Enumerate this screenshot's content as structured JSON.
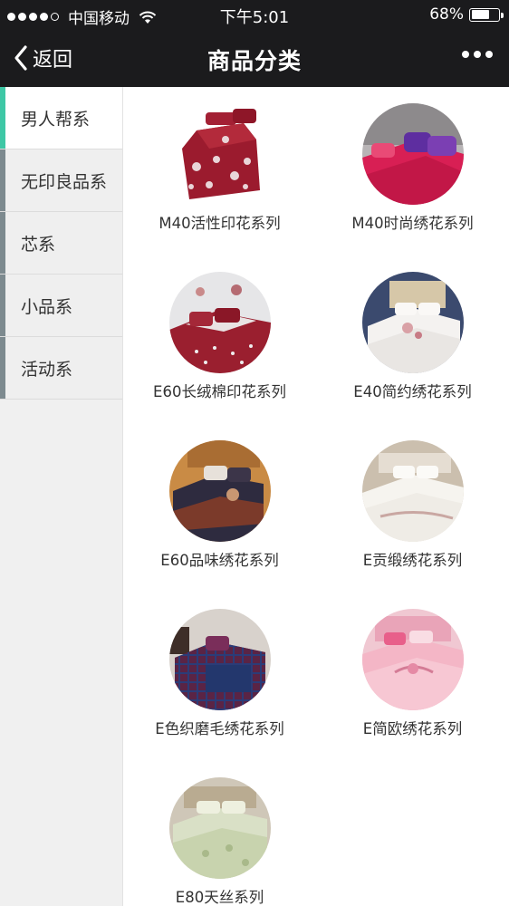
{
  "status_bar": {
    "carrier": "中国移动",
    "time": "下午5:01",
    "battery": "68%",
    "battery_level": 0.68
  },
  "nav": {
    "back_label": "返回",
    "title": "商品分类",
    "more_icon": "ellipsis-icon"
  },
  "sidebar": {
    "items": [
      {
        "label": "男人帮系",
        "active": true
      },
      {
        "label": "无印良品系",
        "active": false
      },
      {
        "label": "芯系",
        "active": false
      },
      {
        "label": "小品系",
        "active": false
      },
      {
        "label": "活动系",
        "active": false
      }
    ]
  },
  "products": [
    {
      "name": "M40活性印花系列"
    },
    {
      "name": "M40时尚绣花系列"
    },
    {
      "name": "E60长绒棉印花系列"
    },
    {
      "name": "E40简约绣花系列"
    },
    {
      "name": "E60品味绣花系列"
    },
    {
      "name": "E贡缎绣花系列"
    },
    {
      "name": "E色织磨毛绣花系列"
    },
    {
      "name": "E简欧绣花系列"
    },
    {
      "name": "E80天丝系列"
    }
  ],
  "colors": {
    "bar_bg": "#1b1b1d",
    "active_indicator": "#3ec7a5",
    "inactive_indicator": "#7d8a8f",
    "sidebar_bg": "#f0f0f0"
  }
}
